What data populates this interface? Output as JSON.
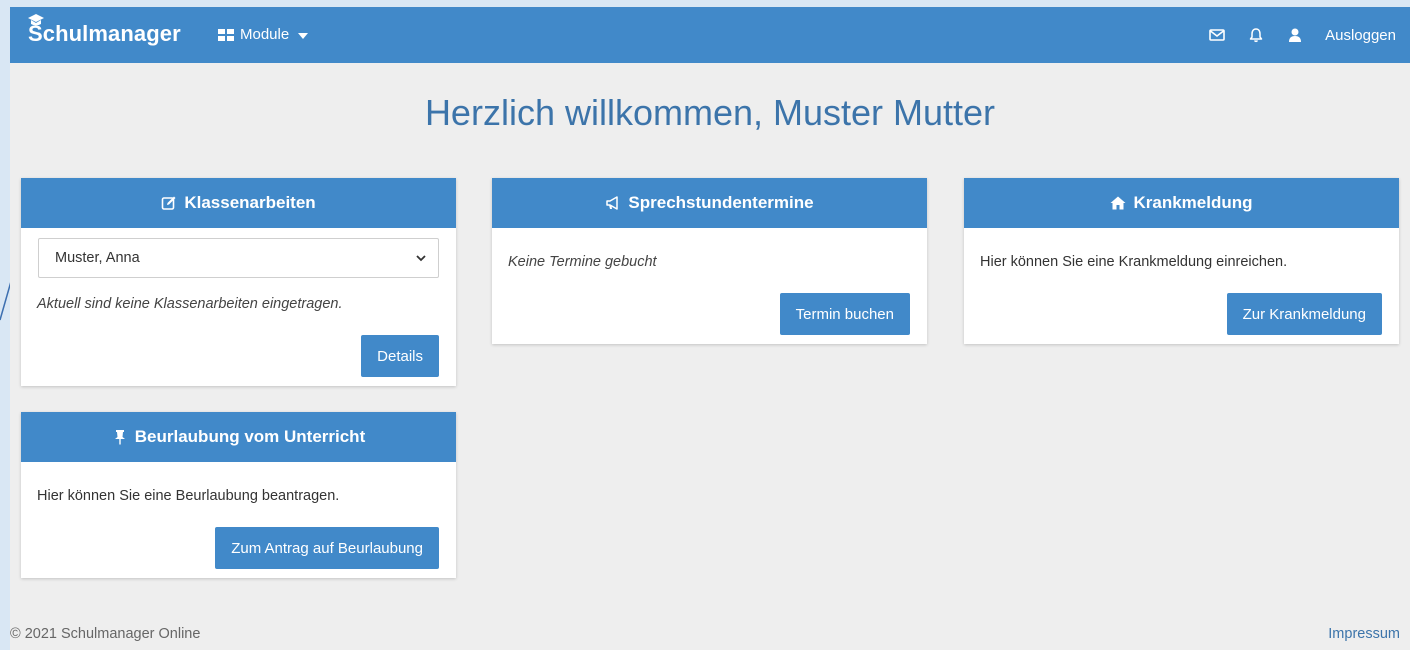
{
  "nav": {
    "brand": "Schulmanager",
    "modules_label": "Module",
    "logout_label": "Ausloggen"
  },
  "welcome": "Herzlich willkommen, Muster Mutter",
  "cards": {
    "klassenarbeiten": {
      "title": "Klassenarbeiten",
      "selected_student": "Muster, Anna",
      "text": "Aktuell sind keine Klassenarbeiten eingetragen.",
      "button": "Details"
    },
    "sprechstunden": {
      "title": "Sprechstundentermine",
      "text": "Keine Termine gebucht",
      "button": "Termin buchen"
    },
    "krankmeldung": {
      "title": "Krankmeldung",
      "text": "Hier können Sie eine Krankmeldung einreichen.",
      "button": "Zur Krankmeldung"
    },
    "beurlaubung": {
      "title": "Beurlaubung vom Unterricht",
      "text": "Hier können Sie eine Beurlaubung beantragen.",
      "button": "Zum Antrag auf Beurlaubung"
    }
  },
  "footer": {
    "copyright": "© 2021 Schulmanager Online",
    "impressum": "Impressum"
  },
  "colors": {
    "primary": "#4189c9",
    "heading": "#3c74aa",
    "background": "#eeeeee"
  },
  "icons": {
    "brand": "graduation-cap-icon",
    "modules": "grid-icon",
    "messages": "envelope-icon",
    "notifications": "bell-icon",
    "user": "user-icon",
    "klassenarbeiten": "edit-icon",
    "sprechstunden": "bullhorn-icon",
    "krankmeldung": "home-icon",
    "beurlaubung": "thumbtack-icon"
  }
}
